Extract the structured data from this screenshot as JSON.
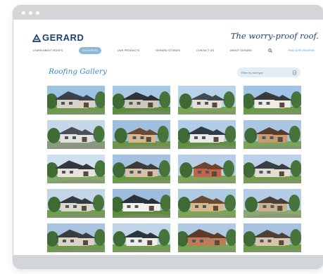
{
  "brand": {
    "name": "GERARD",
    "tagline": "The worry-proof roof."
  },
  "nav": {
    "items": [
      {
        "label": "LEARN ABOUT ROOFS",
        "active": false
      },
      {
        "label": "GALLERIES",
        "active": true
      },
      {
        "label": "OUR PRODUCTS",
        "active": false
      },
      {
        "label": "GERARD STORIES",
        "active": false
      },
      {
        "label": "CONTACT US",
        "active": false
      },
      {
        "label": "ABOUT GERARD",
        "active": false
      }
    ],
    "link": "FIND A RE-ROOFER"
  },
  "gallery": {
    "title": "Roofing Gallery",
    "filter_label": "Filter by roof type"
  },
  "icons": {
    "logo": "gerard-logo-icon",
    "search": "search-icon",
    "filter": "filter-icon"
  },
  "colors": {
    "brand": "#1e3f7a",
    "accent": "#3a86c8",
    "active_nav": "#8fb8d8",
    "chrome": "#d3d6d8"
  }
}
